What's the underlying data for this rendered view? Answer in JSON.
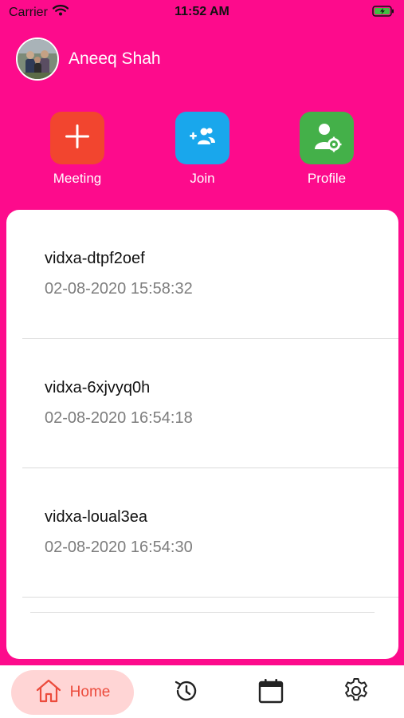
{
  "status_bar": {
    "carrier": "Carrier",
    "time": "11:52 AM",
    "icons": [
      "wifi-icon",
      "battery-charging-icon"
    ]
  },
  "profile": {
    "name": "Aneeq Shah",
    "avatar": "avatar-photo"
  },
  "actions": [
    {
      "label": "Meeting",
      "icon": "plus-icon",
      "color": "#f2452f"
    },
    {
      "label": "Join",
      "icon": "add-people-icon",
      "color": "#19a7ec"
    },
    {
      "label": "Profile",
      "icon": "user-settings-icon",
      "color": "#44b049"
    }
  ],
  "meetings": [
    {
      "id": "vidxa-dtpf2oef",
      "datetime": "02-08-2020 15:58:32"
    },
    {
      "id": "vidxa-6xjvyq0h",
      "datetime": "02-08-2020 16:54:18"
    },
    {
      "id": "vidxa-loual3ea",
      "datetime": "02-08-2020 16:54:30"
    }
  ],
  "tabbar": {
    "home_label": "Home",
    "tabs": [
      "home-icon",
      "history-icon",
      "calendar-icon",
      "settings-icon"
    ]
  },
  "colors": {
    "background": "#fd0b8c",
    "home_tab_bg": "#ffd5d5",
    "home_tab_accent": "#ec4b3c"
  }
}
